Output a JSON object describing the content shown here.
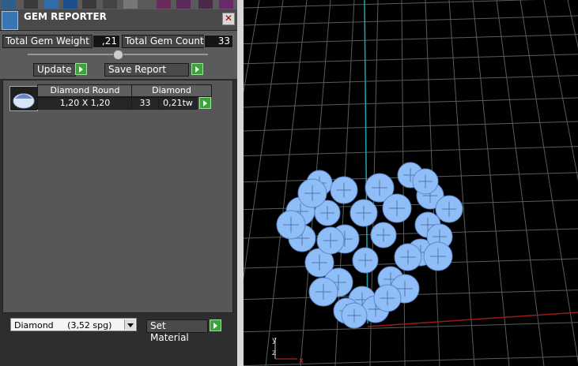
{
  "panel": {
    "title": "GEM REPORTER",
    "close_label": "✕",
    "total_weight_label": "Total Gem Weight",
    "total_weight_value": ",21",
    "total_count_label": "Total Gem Count",
    "total_count_value": "33",
    "update_label": "Update",
    "save_report_label": "Save Report",
    "table": {
      "header": [
        "Diamond Round",
        "Diamond"
      ],
      "size": "1,20 X 1,20",
      "count": "33",
      "weight": "0,21tw"
    },
    "material_select": "Diamond     (3,52 spg)",
    "set_material_label": "Set Material"
  },
  "colors": {
    "gem_fill": "#8fbdf8",
    "grid_line": "#5a5a5a",
    "axis_cyan": "#1aa6b2",
    "axis_red": "#9a1a1a",
    "go_green": "#3aa33a"
  },
  "viewport": {
    "axis_labels": [
      "y",
      "z",
      "x"
    ]
  }
}
